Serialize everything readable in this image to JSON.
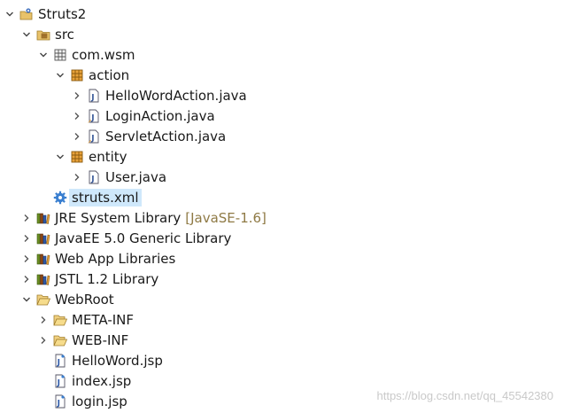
{
  "tree": {
    "project": "Struts2",
    "src": {
      "label": "src",
      "package": {
        "label": "com.wsm",
        "action": {
          "label": "action",
          "files": [
            "HelloWordAction.java",
            "LoginAction.java",
            "ServletAction.java"
          ]
        },
        "entity": {
          "label": "entity",
          "files": [
            "User.java"
          ]
        }
      },
      "config_file": "struts.xml"
    },
    "libraries": [
      {
        "label": "JRE System Library",
        "decoration": "[JavaSE-1.6]"
      },
      {
        "label": "JavaEE 5.0 Generic Library"
      },
      {
        "label": "Web App Libraries"
      },
      {
        "label": "JSTL 1.2 Library"
      }
    ],
    "webroot": {
      "label": "WebRoot",
      "folders": [
        "META-INF",
        "WEB-INF"
      ],
      "files": [
        "HelloWord.jsp",
        "index.jsp",
        "login.jsp"
      ]
    }
  },
  "watermark": "https://blog.csdn.net/qq_45542380",
  "colors": {
    "selection": "#cfe8fb",
    "decoration": "#8f7a45",
    "watermark": "#c9c9c9"
  }
}
